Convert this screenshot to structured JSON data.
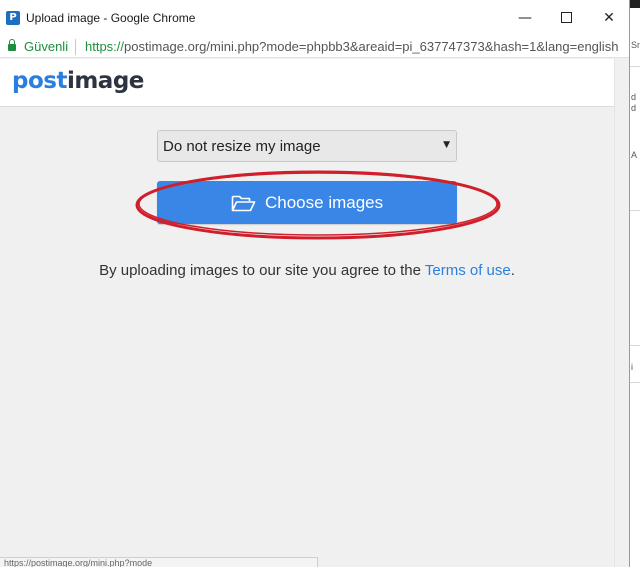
{
  "window": {
    "title": "Upload image - Google Chrome",
    "app_icon_letter": "P",
    "controls": {
      "minimize": "—",
      "close": "✕"
    }
  },
  "addressbar": {
    "secure_label": "Güvenli",
    "url_scheme": "https://",
    "url_rest": "postimage.org/mini.php?mode=phpbb3&areaid=pi_637747373&hash=1&lang=english"
  },
  "site": {
    "logo_post": "post",
    "logo_image": "image"
  },
  "form": {
    "resize_select_value": "Do not resize my image",
    "select_caret": "▼",
    "choose_button_label": "Choose images",
    "agreement_text": "By uploading images to our site you agree to the ",
    "terms_link": "Terms of use",
    "agreement_end": "."
  },
  "statusbar": {
    "text": "https://postimage.org/mini.php?mode"
  },
  "background_window": {
    "fragments": [
      "Sn",
      "d",
      "d",
      "A",
      "i"
    ]
  },
  "colors": {
    "brand_blue": "#2a7fde",
    "button_blue": "#3a86e6",
    "secure_green": "#1e8e3e",
    "annotation_red": "#d01f2b"
  },
  "icons": [
    "lock-icon",
    "folder-open-icon",
    "minimize-icon",
    "maximize-icon",
    "close-icon",
    "dropdown-caret-icon"
  ]
}
